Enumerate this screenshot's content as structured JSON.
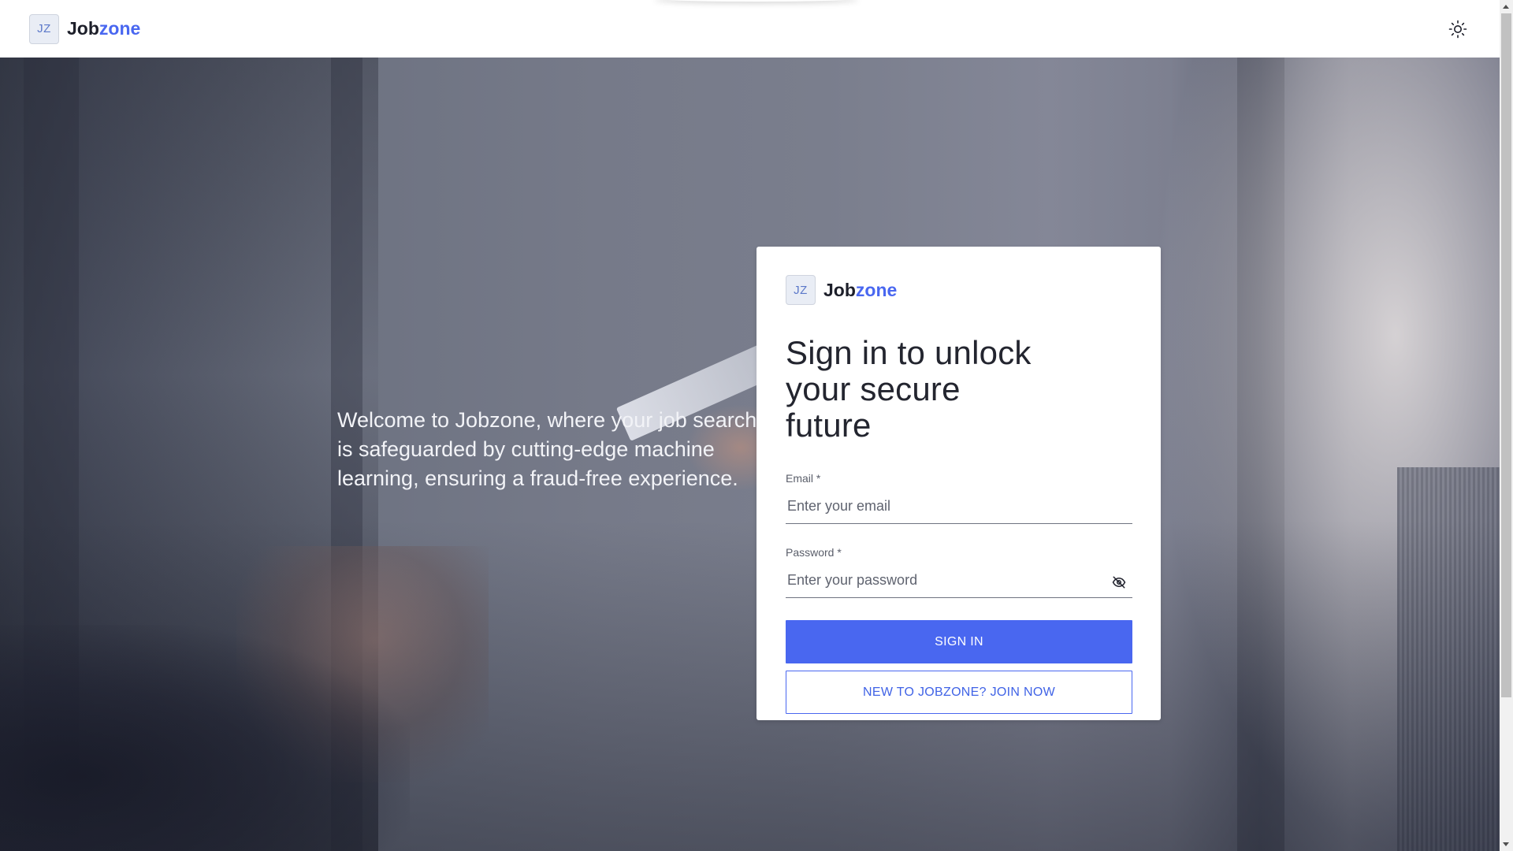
{
  "header": {
    "logo_initials": "JZ",
    "brand_main": "Job",
    "brand_accent": "zone",
    "theme_toggle_icon": "sun-icon"
  },
  "hero": {
    "welcome_text": "Welcome to Jobzone, where your job search is safeguarded by cutting-edge machine learning, ensuring a fraud-free experience."
  },
  "card": {
    "logo_initials": "JZ",
    "brand_main": "Job",
    "brand_accent": "zone",
    "title": "Sign in to unlock your secure future",
    "email": {
      "label": "Email *",
      "placeholder": "Enter your email",
      "value": ""
    },
    "password": {
      "label": "Password *",
      "placeholder": "Enter your password",
      "value": "",
      "visibility_icon": "eye-off-icon"
    },
    "sign_in_label": "SIGN IN",
    "join_label": "NEW TO JOBZONE? JOIN NOW"
  },
  "colors": {
    "accent": "#4967f0",
    "brand_text": "#1d1f2a",
    "logo_tile_bg": "#e9edf5"
  }
}
